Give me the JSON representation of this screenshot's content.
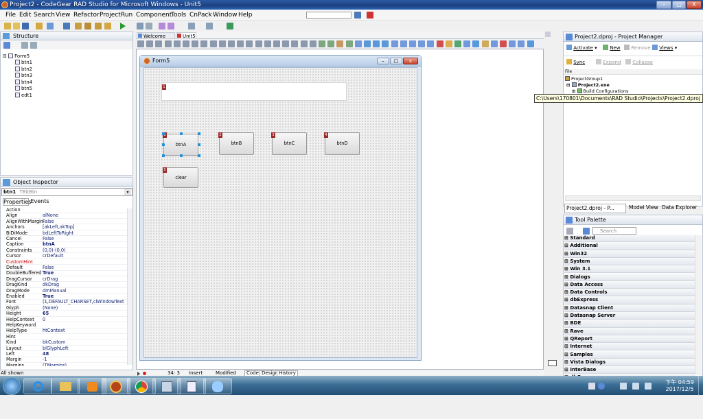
{
  "window": {
    "title": "Project2 - CodeGear RAD Studio for Microsoft Windows - Unit5",
    "min": "–",
    "max": "□",
    "close": "X"
  },
  "menu": [
    "File",
    "Edit",
    "Search",
    "View",
    "Refactor",
    "Project",
    "Run",
    "Component",
    "Tools",
    "CnPack",
    "Window",
    "Help"
  ],
  "structure": {
    "title": "Structure",
    "root": "Form5",
    "items": [
      "btn1",
      "btn2",
      "btn3",
      "btn4",
      "btn5",
      "edt1"
    ]
  },
  "tabs": {
    "welcome": "Welcome Page",
    "unit": "Unit5"
  },
  "form": {
    "title": "Form5",
    "buttons": [
      {
        "caption": "btnA",
        "tag": "1"
      },
      {
        "caption": "btnB",
        "tag": "2"
      },
      {
        "caption": "btnC",
        "tag": "3"
      },
      {
        "caption": "btnD",
        "tag": "4"
      },
      {
        "caption": "clear",
        "tag": "5"
      }
    ],
    "edit_tag": "1"
  },
  "object_inspector": {
    "title": "Object Inspector",
    "selected": "btn1",
    "selected_type": "TBitBtn",
    "tab_properties": "Properties",
    "tab_events": "Events",
    "rows": [
      {
        "name": "Action",
        "value": ""
      },
      {
        "name": "Align",
        "value": "alNone"
      },
      {
        "name": "AlignWithMargins",
        "value": "False"
      },
      {
        "name": "Anchors",
        "value": "[akLeft,akTop]"
      },
      {
        "name": "BiDiMode",
        "value": "bdLeftToRight"
      },
      {
        "name": "Cancel",
        "value": "False"
      },
      {
        "name": "Caption",
        "value": "btnA"
      },
      {
        "name": "Constraints",
        "value": "(0,0)-(0,0)"
      },
      {
        "name": "Cursor",
        "value": "crDefault"
      },
      {
        "name": "CustomHint",
        "value": ""
      },
      {
        "name": "Default",
        "value": "False"
      },
      {
        "name": "DoubleBuffered",
        "value": "True"
      },
      {
        "name": "DragCursor",
        "value": "crDrag"
      },
      {
        "name": "DragKind",
        "value": "dkDrag"
      },
      {
        "name": "DragMode",
        "value": "dmManual"
      },
      {
        "name": "Enabled",
        "value": "True"
      },
      {
        "name": "Font",
        "value": "(1,DEFAULT_CHARSET,clWindowText"
      },
      {
        "name": "Glyph",
        "value": "(None)"
      },
      {
        "name": "Height",
        "value": "65"
      },
      {
        "name": "HelpContext",
        "value": "0"
      },
      {
        "name": "HelpKeyword",
        "value": ""
      },
      {
        "name": "HelpType",
        "value": "htContext"
      },
      {
        "name": "Hint",
        "value": ""
      },
      {
        "name": "Kind",
        "value": "bkCustom"
      },
      {
        "name": "Layout",
        "value": "blGlyphLeft"
      },
      {
        "name": "Left",
        "value": "48"
      },
      {
        "name": "Margin",
        "value": "-1"
      },
      {
        "name": "Margins",
        "value": "(TMargins)"
      }
    ],
    "status": "All shown"
  },
  "statusbar": {
    "position": "34: 3",
    "mode": "Insert",
    "state": "Modified",
    "tab_code": "Code",
    "tab_design": "Design",
    "tab_history": "History"
  },
  "project_manager": {
    "title": "Project2.dproj - Project Manager",
    "activate": "Activate",
    "new": "New",
    "remove": "Remove",
    "views": "Views",
    "sync": "Sync",
    "expand": "Expand",
    "collapse": "Collapse",
    "file_header": "File",
    "tree": [
      "ProjectGroup1",
      "Project2.exe",
      "Build Configurations"
    ],
    "tooltip": "C:\\Users\\170801\\Documents\\RAD Studio\\Projects\\Project2.dproj",
    "tabs": [
      "Project2.dproj - P...",
      "Model View",
      "Data Explorer"
    ]
  },
  "tool_palette": {
    "title": "Tool Palette",
    "search_placeholder": "Search",
    "categories": [
      "Standard",
      "Additional",
      "Win32",
      "System",
      "Win 3.1",
      "Dialogs",
      "Data Access",
      "Data Controls",
      "dbExpress",
      "Datasnap Client",
      "Datasnap Server",
      "BDE",
      "Rave",
      "QReport",
      "Internet",
      "Samples",
      "Vista Dialogs",
      "InterBase",
      "dbGo"
    ]
  },
  "clock": {
    "time": "下午 04:59",
    "date": "2017/12/5"
  }
}
